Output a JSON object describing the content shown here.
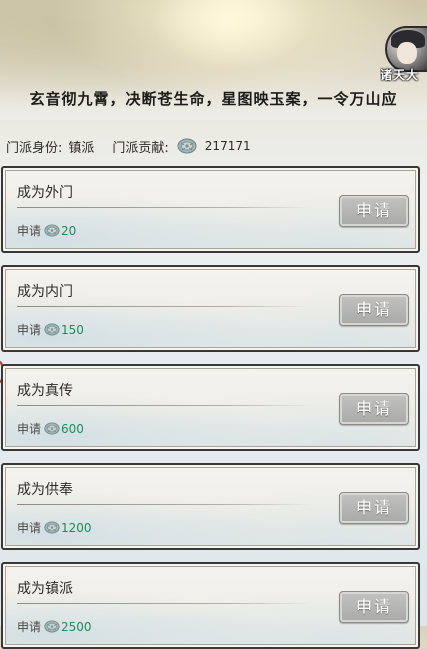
{
  "header": {
    "avatar_name": "诸天大",
    "motto": "玄音彻九霄，决断苍生命，星图映玉案，一令万山应"
  },
  "sect_info": {
    "identity_label": "门派身份:",
    "identity_value": "镇派",
    "contribution_label": "门派贡献:",
    "contribution_icon": "jade-currency-icon",
    "contribution_value": "217171"
  },
  "ranks": [
    {
      "title": "成为外门",
      "cost_label": "申请",
      "cost_value": "20",
      "button_label": "申请"
    },
    {
      "title": "成为内门",
      "cost_label": "申请",
      "cost_value": "150",
      "button_label": "申请"
    },
    {
      "title": "成为真传",
      "cost_label": "申请",
      "cost_value": "600",
      "button_label": "申请"
    },
    {
      "title": "成为供奉",
      "cost_label": "申请",
      "cost_value": "1200",
      "button_label": "申请"
    },
    {
      "title": "成为镇派",
      "cost_label": "申请",
      "cost_value": "2500",
      "button_label": "申请"
    }
  ],
  "colors": {
    "cost_value": "#1f8c5c",
    "button_bg": "#b1b1af",
    "card_border": "#3a3836"
  }
}
